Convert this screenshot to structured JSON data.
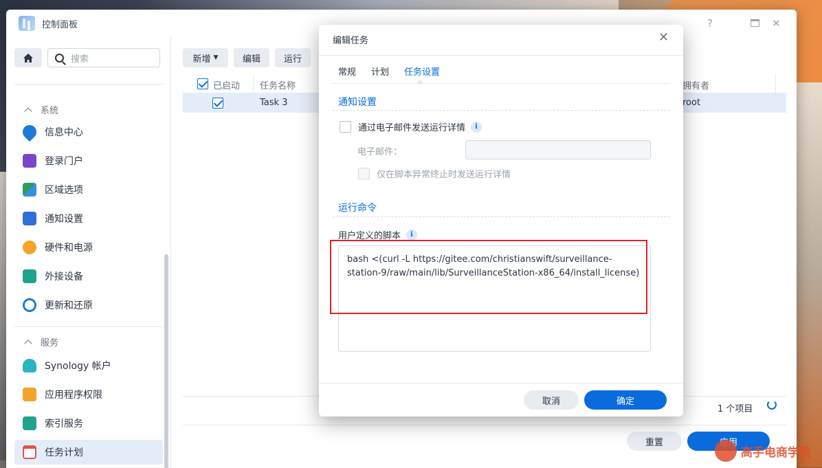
{
  "window": {
    "title": "控制面板"
  },
  "sidebar": {
    "search_placeholder": "搜索",
    "section_system": "系统",
    "section_services": "服务",
    "items": [
      {
        "label": "信息中心",
        "icon": "info-icon",
        "color": "#1e7ad6"
      },
      {
        "label": "登录门户",
        "icon": "login-portal-icon",
        "color": "#7a46c8"
      },
      {
        "label": "区域选项",
        "icon": "region-icon",
        "color": "#2e9c5a"
      },
      {
        "label": "通知设置",
        "icon": "notification-icon",
        "color": "#2f6fd6"
      },
      {
        "label": "硬件和电源",
        "icon": "power-icon",
        "color": "#f2a52a"
      },
      {
        "label": "外接设备",
        "icon": "external-device-icon",
        "color": "#1fa38a"
      },
      {
        "label": "更新和还原",
        "icon": "update-icon",
        "color": "#1e7ad6"
      },
      {
        "label": "Synology 帐户",
        "icon": "account-icon",
        "color": "#2bb3c6"
      },
      {
        "label": "应用程序权限",
        "icon": "lock-icon",
        "color": "#f2a52a"
      },
      {
        "label": "索引服务",
        "icon": "index-icon",
        "color": "#1fa38a"
      },
      {
        "label": "任务计划",
        "icon": "calendar-icon",
        "color": "#e0524a"
      }
    ]
  },
  "toolbar": {
    "add": "新增",
    "edit": "编辑",
    "run": "运行"
  },
  "table": {
    "col_enabled": "已启动",
    "col_name": "任务名称",
    "col_owner": "拥有者",
    "rows": [
      {
        "enabled": true,
        "name": "Task 3",
        "owner": "root"
      }
    ],
    "count": "1 个项目"
  },
  "footer": {
    "reset": "重置",
    "apply": "应用"
  },
  "modal": {
    "title": "编辑任务",
    "tabs": [
      "常规",
      "计划",
      "任务设置"
    ],
    "active_tab": "任务设置",
    "notify_section": "通知设置",
    "email_option": "通过电子邮件发送运行详情",
    "email_label": "电子邮件：",
    "abnormal_option": "仅在脚本异常终止时发送运行详情",
    "run_section": "运行命令",
    "script_label": "用户定义的脚本",
    "script": "bash <(curl -L https://gitee.com/christianswift/surveillance-station-9/raw/main/lib/SurveillanceStation-x86_64/install_license)",
    "cancel": "取消",
    "ok": "确定"
  },
  "watermark": "高手电商学院",
  "colors": {
    "accent": "#0a6cdc",
    "highlight": "#e3202a"
  }
}
